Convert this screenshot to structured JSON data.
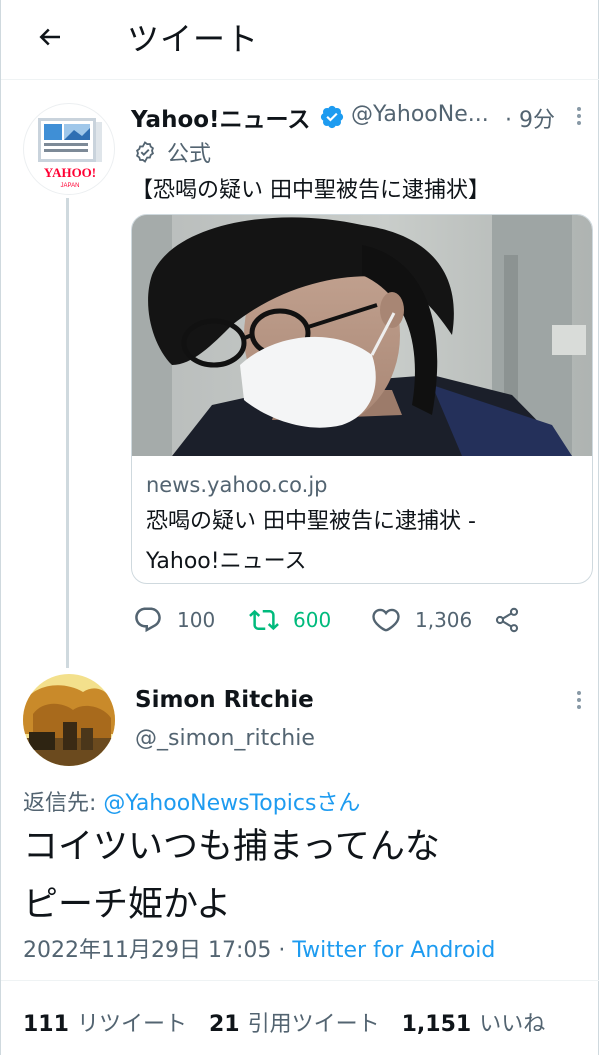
{
  "header": {
    "title": "ツイート"
  },
  "parent_tweet": {
    "name": "Yahoo!ニュース",
    "handle": "@YahooNe...",
    "time": "· 9分",
    "official_label": "公式",
    "text": "【恐喝の疑い 田中聖被告に逮捕状】",
    "avatar_logo_text": "YAHOO!",
    "avatar_logo_sub": "JAPAN",
    "card": {
      "domain": "news.yahoo.co.jp",
      "title": "恐喝の疑い 田中聖被告に逮捕状 -",
      "site": "Yahoo!ニュース"
    },
    "actions": {
      "replies": "100",
      "retweets": "600",
      "likes": "1,306"
    }
  },
  "reply_tweet": {
    "name": "Simon Ritchie",
    "handle": "@_simon_ritchie",
    "reply_prefix": "返信先: ",
    "reply_mention": "@YahooNewsTopicsさん",
    "text_line1": "コイツいつも捕まってんな",
    "text_line2": "ピーチ姫かよ",
    "timestamp": "2022年11月29日 17:05 · ",
    "source": "Twitter for Android",
    "stats": {
      "retweets_num": "111",
      "retweets_label": "リツイート",
      "quotes_num": "21",
      "quotes_label": "引用ツイート",
      "likes_num": "1,151",
      "likes_label": "いいね"
    }
  },
  "colors": {
    "accent": "#1d9bf0",
    "retweet": "#00ba7c",
    "muted": "#536471",
    "text": "#0f1419",
    "yahoo_red": "#ff0033"
  }
}
